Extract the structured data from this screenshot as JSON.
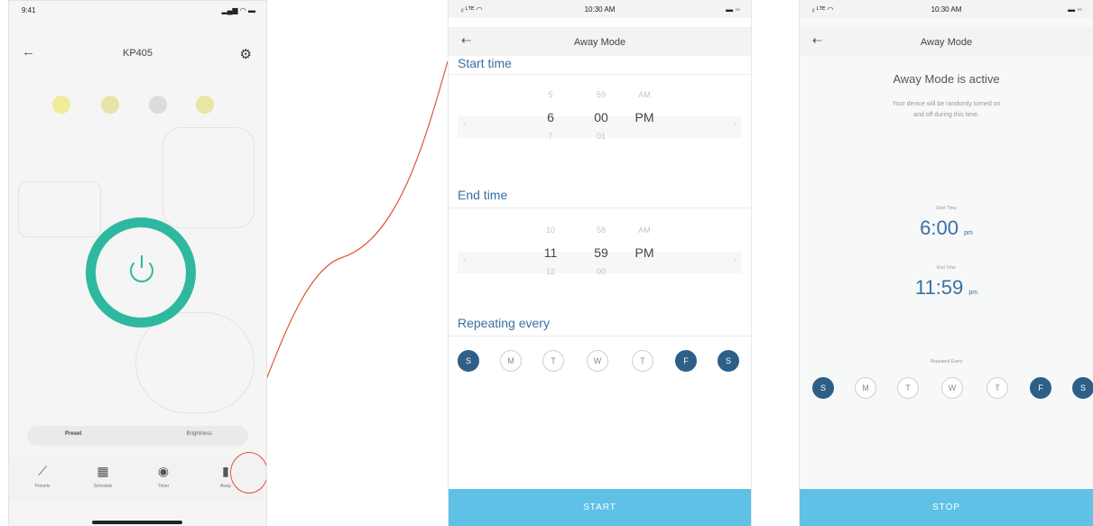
{
  "screen1": {
    "status": {
      "time": "9:41",
      "signal": "▂▄▆ ◠ ▬"
    },
    "title": "KP405",
    "bulb_colors": [
      "#f1eb9c",
      "#e6e4a8",
      "#dcdcdc",
      "#e8e6a2"
    ],
    "switch_tabs": [
      "Preset",
      "Brightness"
    ],
    "toolbar": [
      {
        "label": "Presets",
        "icon": "⟋"
      },
      {
        "label": "Schedule",
        "icon": "▦"
      },
      {
        "label": "Timer",
        "icon": "◉"
      },
      {
        "label": "Away",
        "icon": "▮"
      }
    ],
    "accent": "#2fb8a0",
    "highlight": "#e0563b"
  },
  "screen2": {
    "status": {
      "left": "ᵢₗ ᴸᵀᴱ ◠",
      "center": "10:30 AM",
      "right": "▬ ◦◦"
    },
    "title": "Away Mode",
    "start_label": "Start time",
    "start_picker": {
      "above": [
        "5",
        "59",
        "AM"
      ],
      "selected": [
        "6",
        "00",
        "PM"
      ],
      "below": [
        "7",
        "01",
        ""
      ]
    },
    "end_label": "End time",
    "end_picker": {
      "above": [
        "10",
        "58",
        "AM"
      ],
      "selected": [
        "11",
        "59",
        "PM"
      ],
      "below": [
        "12",
        "00",
        ""
      ]
    },
    "repeat_label": "Repeating every",
    "days": [
      {
        "d": "S",
        "on": true
      },
      {
        "d": "M",
        "on": false
      },
      {
        "d": "T",
        "on": false
      },
      {
        "d": "W",
        "on": false
      },
      {
        "d": "T",
        "on": false
      },
      {
        "d": "F",
        "on": true
      },
      {
        "d": "S",
        "on": true
      }
    ],
    "button": "START"
  },
  "screen3": {
    "status": {
      "left": "ᵢₗ ᴸᵀᴱ ◠",
      "center": "10:30 AM",
      "right": "▬ ◦◦"
    },
    "title": "Away Mode",
    "active_title": "Away Mode is active",
    "active_sub_1": "Your device will be randomly turned on",
    "active_sub_2": "and off during this time.",
    "start_label": "Start Time",
    "start_value": "6:00",
    "start_ampm": "pm",
    "end_label": "End Time",
    "end_value": "11:59",
    "end_ampm": "pm",
    "repeat_label": "Repeated Every",
    "days": [
      {
        "d": "S",
        "on": true
      },
      {
        "d": "M",
        "on": false
      },
      {
        "d": "T",
        "on": false
      },
      {
        "d": "W",
        "on": false
      },
      {
        "d": "T",
        "on": false
      },
      {
        "d": "F",
        "on": true
      },
      {
        "d": "S",
        "on": true
      }
    ],
    "button": "STOP"
  }
}
